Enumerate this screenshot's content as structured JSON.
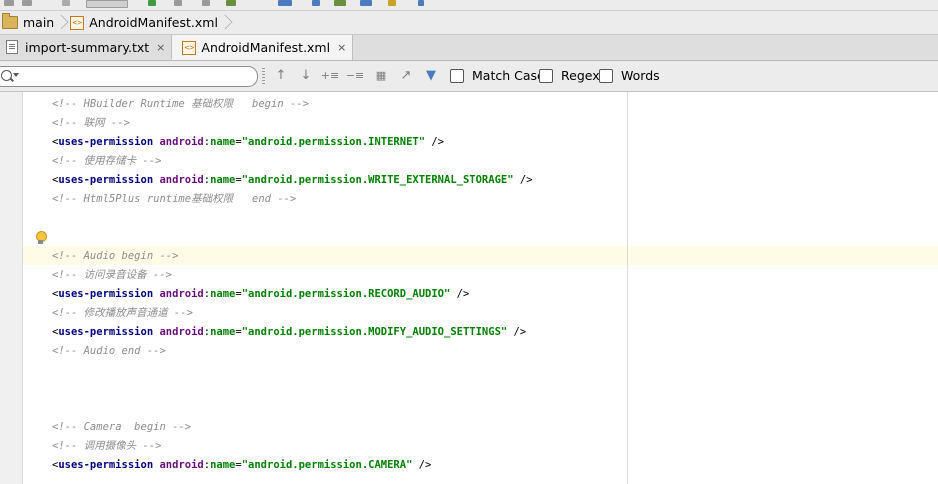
{
  "breadcrumb": {
    "items": [
      {
        "label": "main",
        "icon": "folder-icon"
      },
      {
        "label": "AndroidManifest.xml",
        "icon": "xml-file-icon"
      }
    ]
  },
  "tabs": [
    {
      "label": "import-summary.txt",
      "icon": "text-file-icon",
      "active": false
    },
    {
      "label": "AndroidManifest.xml",
      "icon": "xml-file-icon",
      "active": true
    }
  ],
  "find": {
    "value": "",
    "match_case_label": "Match Case",
    "regex_label": "Regex",
    "words_label": "Words",
    "close_glyph": "×"
  },
  "code": {
    "lines": [
      {
        "type": "comment",
        "text": "<!-- HBuilder Runtime 基础权限   begin -->"
      },
      {
        "type": "comment",
        "text": "<!-- 联网 -->"
      },
      {
        "type": "perm",
        "value": "android.permission.INTERNET"
      },
      {
        "type": "comment",
        "text": "<!-- 使用存储卡 -->"
      },
      {
        "type": "perm",
        "value": "android.permission.WRITE_EXTERNAL_STORAGE"
      },
      {
        "type": "comment",
        "text": "<!-- Html5Plus runtime基础权限   end -->"
      },
      {
        "type": "blank"
      },
      {
        "type": "blank"
      },
      {
        "type": "comment",
        "text": "<!-- Audio begin -->"
      },
      {
        "type": "comment",
        "text": "<!-- 访问录音设备 -->"
      },
      {
        "type": "perm",
        "value": "android.permission.RECORD_AUDIO"
      },
      {
        "type": "comment",
        "text": "<!-- 修改播放声音通道 -->"
      },
      {
        "type": "perm",
        "value": "android.permission.MODIFY_AUDIO_SETTINGS"
      },
      {
        "type": "comment",
        "text": "<!-- Audio end -->"
      },
      {
        "type": "blank"
      },
      {
        "type": "blank"
      },
      {
        "type": "blank"
      },
      {
        "type": "comment",
        "text": "<!-- Camera  begin -->"
      },
      {
        "type": "comment",
        "text": "<!-- 调用摄像头 -->"
      },
      {
        "type": "perm",
        "value": "android.permission.CAMERA"
      }
    ],
    "tag_open": "<",
    "tag_name": "uses-permission",
    "attr_prefix": "android",
    "attr_colon": ":",
    "attr_name": "name",
    "eq": "=",
    "quote": "\"",
    "tag_close": " />"
  },
  "colors": {
    "comment": "#8c8c8c",
    "tag": "#000080",
    "attribute": "#660e7a",
    "value": "#008000",
    "caret_row": "#fefbe6"
  }
}
